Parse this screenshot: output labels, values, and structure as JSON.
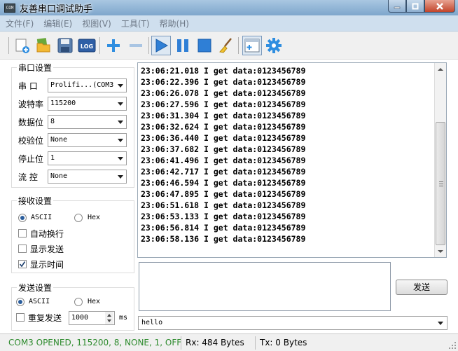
{
  "window": {
    "title": "友善串口调试助手",
    "icon_text": "COM"
  },
  "menu": [
    "文件(F)",
    "编辑(E)",
    "视图(V)",
    "工具(T)",
    "帮助(H)"
  ],
  "toolbar": {
    "log_label": "LOG"
  },
  "serial": {
    "title": "串口设置",
    "port_label": "串  口",
    "port_value": "Prolifi...(COM3",
    "baud_label": "波特率",
    "baud_value": "115200",
    "data_label": "数据位",
    "data_value": "8",
    "parity_label": "校验位",
    "parity_value": "None",
    "stop_label": "停止位",
    "stop_value": "1",
    "flow_label": "流  控",
    "flow_value": "None"
  },
  "receive": {
    "title": "接收设置",
    "ascii_label": "ASCII",
    "hex_label": "Hex",
    "auto_wrap": "自动换行",
    "show_send": "显示发送",
    "show_time": "显示时间",
    "lines": [
      "23:06:21.018 I get data:0123456789",
      "23:06:22.396 I get data:0123456789",
      "23:06:26.078 I get data:0123456789",
      "23:06:27.596 I get data:0123456789",
      "23:06:31.304 I get data:0123456789",
      "23:06:32.624 I get data:0123456789",
      "23:06:36.440 I get data:0123456789",
      "23:06:37.682 I get data:0123456789",
      "23:06:41.496 I get data:0123456789",
      "23:06:42.717 I get data:0123456789",
      "23:06:46.594 I get data:0123456789",
      "23:06:47.895 I get data:0123456789",
      "23:06:51.618 I get data:0123456789",
      "23:06:53.133 I get data:0123456789",
      "23:06:56.814 I get data:0123456789",
      "23:06:58.136 I get data:0123456789"
    ]
  },
  "send": {
    "title": "发送设置",
    "ascii_label": "ASCII",
    "hex_label": "Hex",
    "repeat_label": "重复发送",
    "interval_value": "1000",
    "interval_unit": "ms",
    "button_label": "发送",
    "history_value": "hello"
  },
  "status": {
    "port_status": "COM3 OPENED, 115200, 8, NONE, 1, OFF",
    "rx": "Rx: 484 Bytes",
    "tx": "Tx: 0 Bytes",
    "port_status_color": "#2e8b2e"
  }
}
